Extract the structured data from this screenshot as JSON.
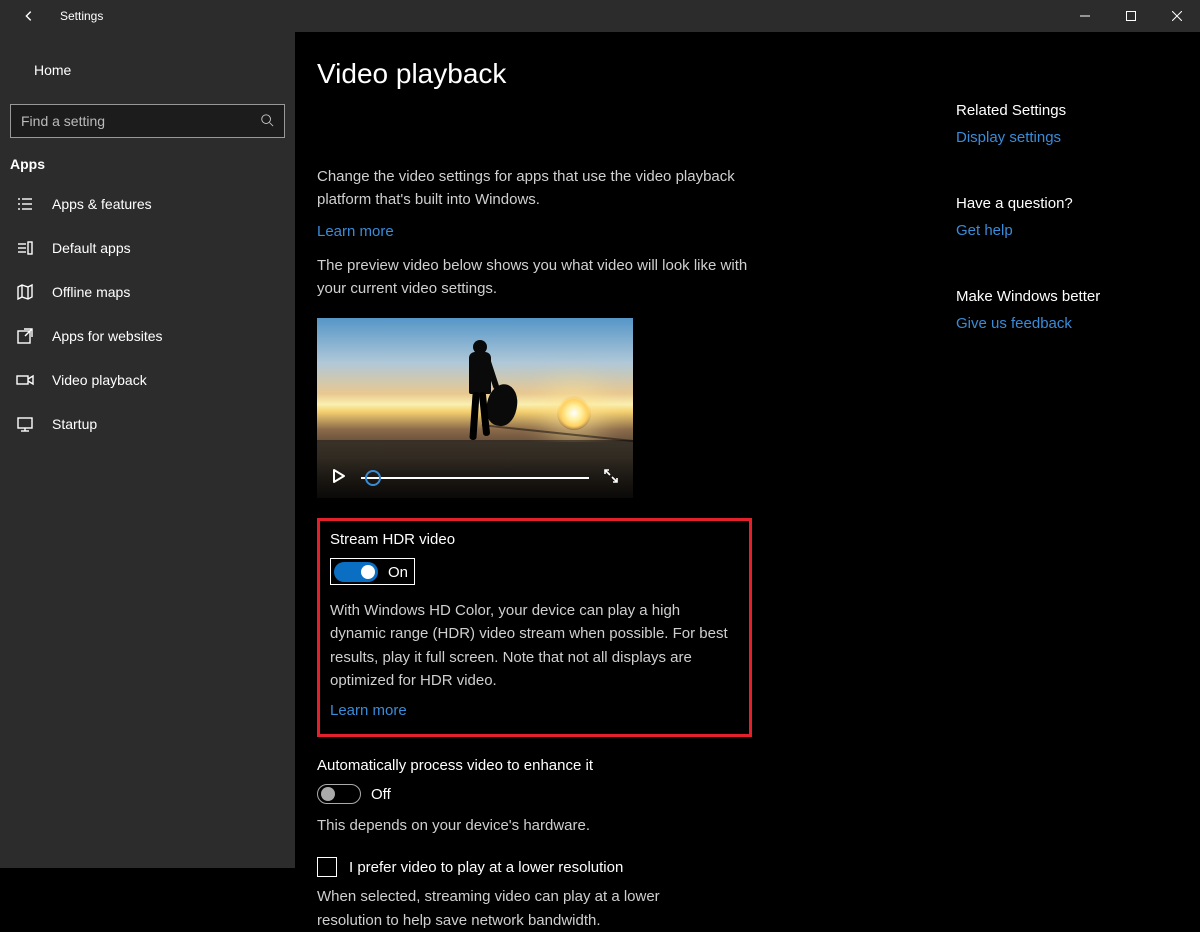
{
  "window": {
    "title": "Settings"
  },
  "sidebar": {
    "home": "Home",
    "search_placeholder": "Find a setting",
    "section": "Apps",
    "items": [
      {
        "label": "Apps & features"
      },
      {
        "label": "Default apps"
      },
      {
        "label": "Offline maps"
      },
      {
        "label": "Apps for websites"
      },
      {
        "label": "Video playback"
      },
      {
        "label": "Startup"
      }
    ]
  },
  "main": {
    "title": "Video playback",
    "intro": "Change the video settings for apps that use the video playback platform that's built into Windows.",
    "learn_more": "Learn more",
    "preview_desc": "The preview video below shows you what video will look like with your current video settings.",
    "hdr": {
      "title": "Stream HDR video",
      "state": "On",
      "desc": "With Windows HD Color, your device can play a high dynamic range (HDR) video stream when possible. For best results, play it full screen. Note that not all displays are optimized for HDR video.",
      "learn_more": "Learn more"
    },
    "autoprocess": {
      "title": "Automatically process video to enhance it",
      "state": "Off",
      "desc": "This depends on your device's hardware."
    },
    "lowres": {
      "label": "I prefer video to play at a lower resolution",
      "desc": "When selected, streaming video can play at a lower resolution to help save network bandwidth."
    }
  },
  "right": {
    "related_title": "Related Settings",
    "related_link": "Display settings",
    "question_title": "Have a question?",
    "question_link": "Get help",
    "feedback_title": "Make Windows better",
    "feedback_link": "Give us feedback"
  }
}
